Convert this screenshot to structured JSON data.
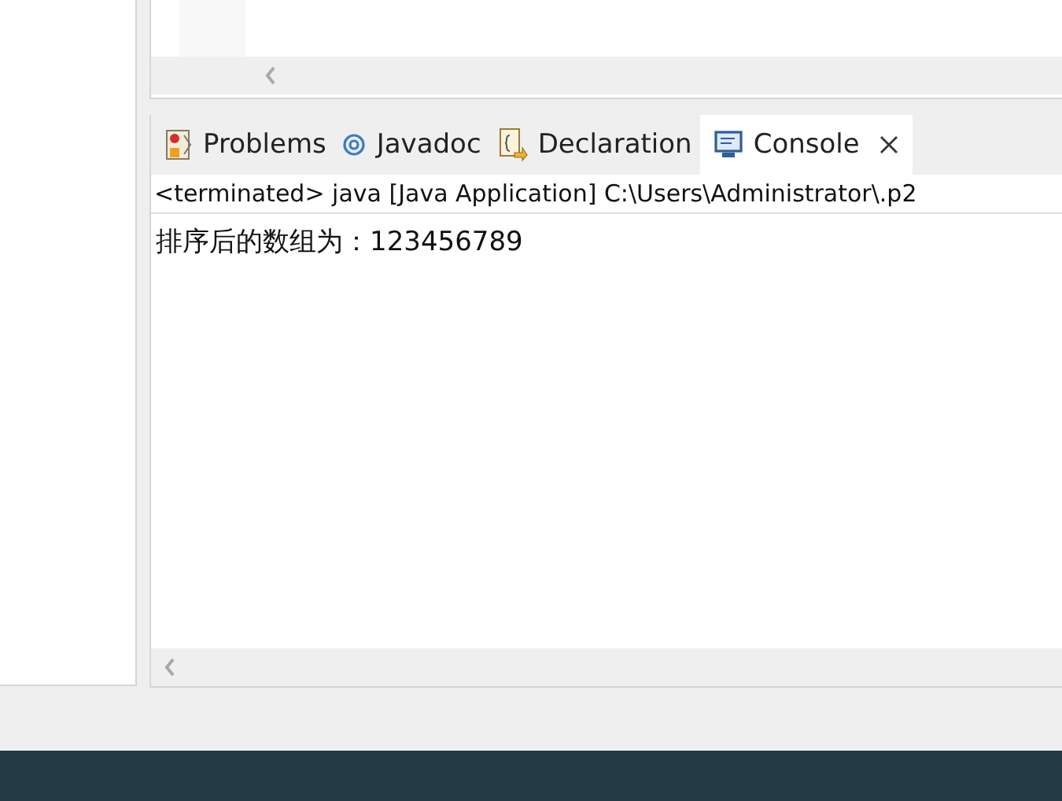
{
  "tabs": [
    {
      "label": "Problems",
      "kind": "problems",
      "selected": false
    },
    {
      "label": "Javadoc",
      "kind": "javadoc",
      "selected": false
    },
    {
      "label": "Declaration",
      "kind": "declaration",
      "selected": false
    },
    {
      "label": "Console",
      "kind": "console",
      "selected": true
    }
  ],
  "console": {
    "header": "<terminated> java [Java Application] C:\\Users\\Administrator\\.p2",
    "output": [
      "排序后的数组为：123456789"
    ]
  }
}
